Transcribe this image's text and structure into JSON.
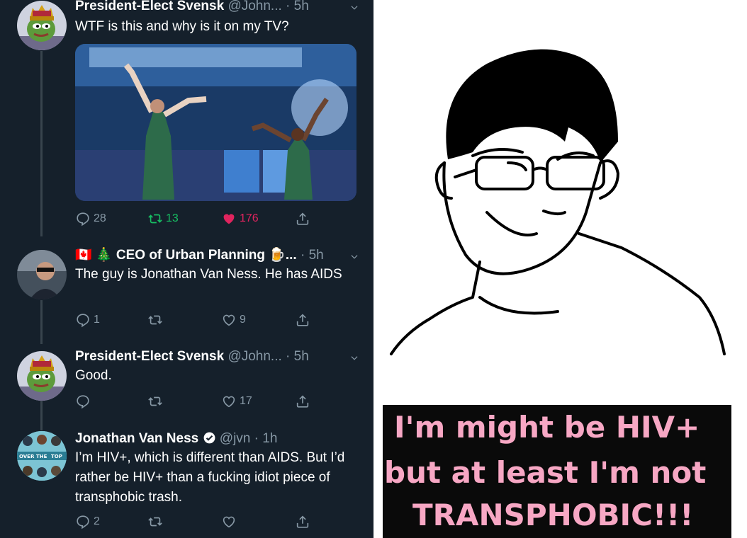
{
  "tweets": [
    {
      "name": "President-Elect Svensk",
      "handle_time": "@John... · 5h",
      "text": "WTF is this and why is it on my TV?",
      "counts": {
        "reply": "28",
        "retweet": "13",
        "like": "176"
      }
    },
    {
      "name_prefix": "🇨🇦 🎄",
      "name": "CEO of Urban Planning",
      "name_suffix": "🍺...",
      "handle_time": "· 5h",
      "text": "The guy is Jonathan Van Ness. He has AIDS",
      "counts": {
        "reply": "1",
        "retweet": "",
        "like": "9"
      }
    },
    {
      "name": "President-Elect Svensk",
      "handle_time": "@John... · 5h",
      "text": "Good.",
      "counts": {
        "reply": "",
        "retweet": "",
        "like": "17"
      }
    },
    {
      "name": "Jonathan Van Ness",
      "handle_time": "@jvn · 1h",
      "text": "I’m HIV+, which is different than AIDS. But I’d rather be HIV+ than a fucking idiot piece of transphobic trash.",
      "counts": {
        "reply": "2",
        "retweet": "",
        "like": ""
      },
      "avatar_text": [
        "OVER",
        "THE",
        "TOP"
      ]
    }
  ],
  "meme": {
    "caption_lines": [
      "I'm might be HIV+",
      "but at least I'm not",
      "TRANSPHOBIC!!!"
    ]
  },
  "colors": {
    "background": "#15202b",
    "secondary_text": "#8899a6",
    "retweet_green": "#17bf63",
    "like_pink": "#e0245e",
    "caption_pink": "#f7a7c4"
  },
  "icons": [
    "reply-icon",
    "retweet-icon",
    "heart-icon",
    "share-icon",
    "chevron-down-icon",
    "verified-badge-icon"
  ]
}
